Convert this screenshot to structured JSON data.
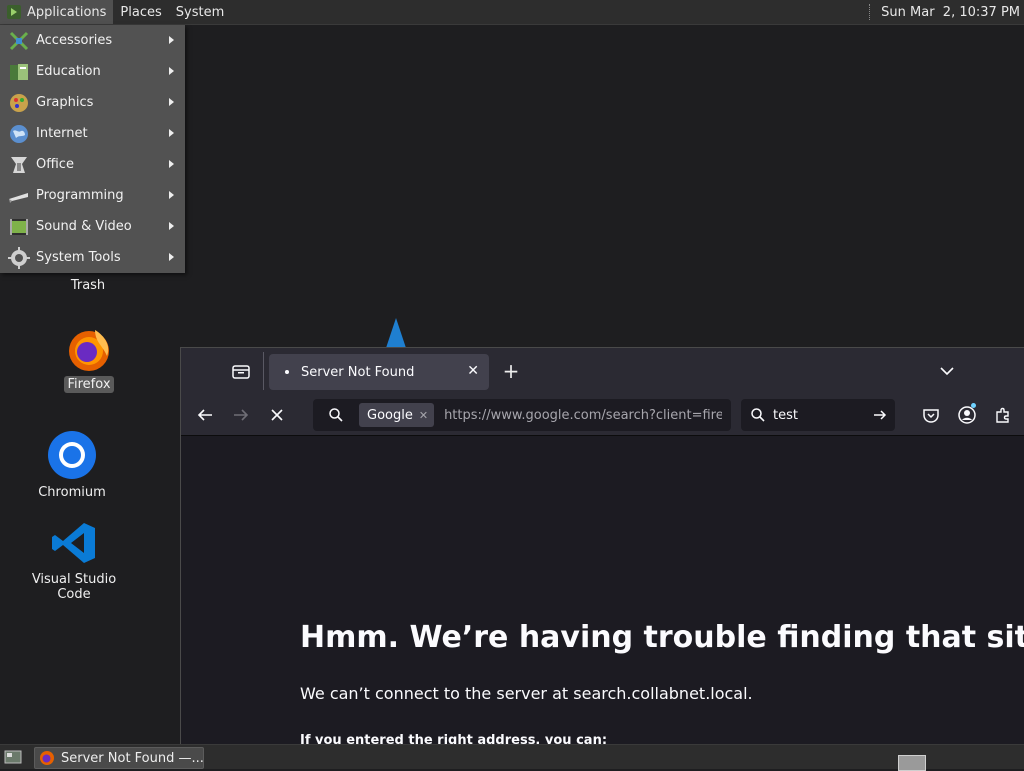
{
  "top_panel": {
    "applications": "Applications",
    "places": "Places",
    "system": "System",
    "clock": "Sun Mar  2, 10:37 PM"
  },
  "apps_menu": {
    "items": [
      {
        "label": "Accessories",
        "icon": "accessories-icon"
      },
      {
        "label": "Education",
        "icon": "education-icon"
      },
      {
        "label": "Graphics",
        "icon": "graphics-icon"
      },
      {
        "label": "Internet",
        "icon": "internet-icon"
      },
      {
        "label": "Office",
        "icon": "office-icon"
      },
      {
        "label": "Programming",
        "icon": "programming-icon"
      },
      {
        "label": "Sound & Video",
        "icon": "sound-video-icon"
      },
      {
        "label": "System Tools",
        "icon": "system-tools-icon"
      }
    ]
  },
  "desktop": {
    "trash": "Trash",
    "firefox": "Firefox",
    "chromium": "Chromium",
    "vscode": "Visual Studio Code"
  },
  "browser": {
    "tab_title": "Server Not Found",
    "search_engine": "Google",
    "url": "https://www.google.com/search?client=firef",
    "search_query": "test",
    "error_title": "Hmm. We’re having trouble finding that site.",
    "error_desc": "We can’t connect to the server at search.collabnet.local.",
    "error_more": "If you entered the right address, you can:"
  },
  "taskbar": {
    "window_title": "Server Not Found —..."
  }
}
